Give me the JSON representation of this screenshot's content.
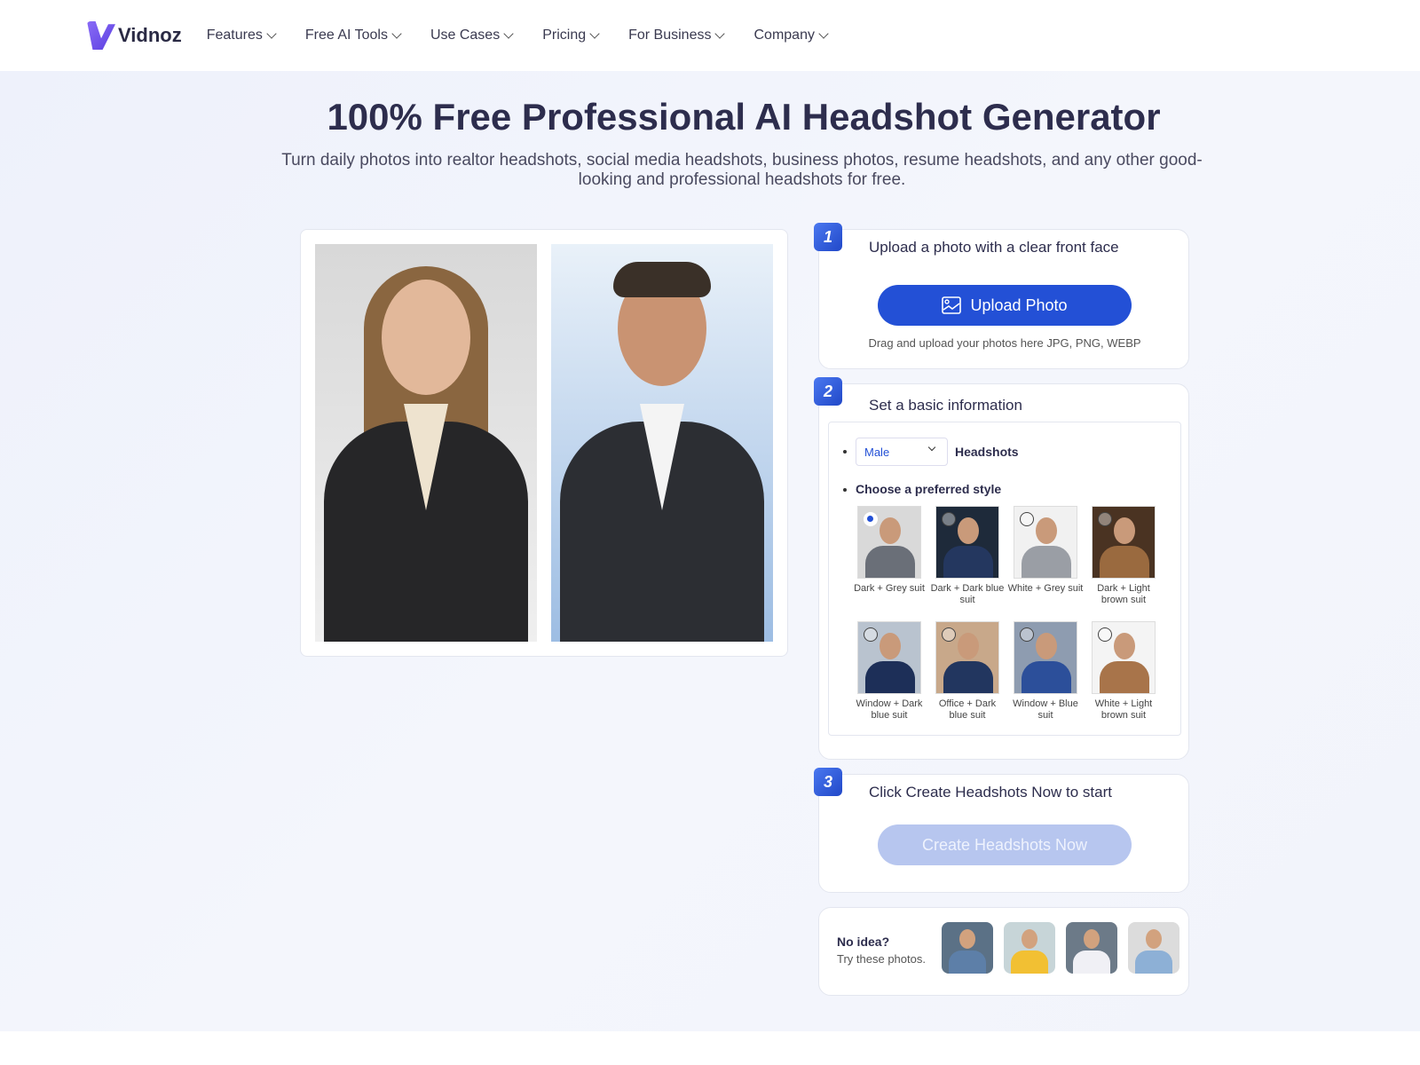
{
  "nav": {
    "logo": "Vidnoz",
    "items": [
      {
        "label": "Features"
      },
      {
        "label": "Free AI Tools"
      },
      {
        "label": "Use Cases"
      },
      {
        "label": "Pricing"
      },
      {
        "label": "For Business"
      },
      {
        "label": "Company"
      }
    ]
  },
  "hero": {
    "title": "100% Free Professional AI Headshot Generator",
    "subtitle": "Turn daily photos into realtor headshots, social media headshots, business photos, resume headshots, and any other good-looking and professional headshots for free."
  },
  "step1": {
    "number": "1",
    "title": "Upload a photo with a clear front face",
    "button": "Upload Photo",
    "hint": "Drag and upload your photos here JPG, PNG, WEBP"
  },
  "step2": {
    "number": "2",
    "title": "Set a basic information",
    "gender": "Male",
    "headshots_label": "Headshots",
    "style_label": "Choose a preferred style",
    "styles": [
      {
        "name": "Dark + Grey suit",
        "selected": true,
        "bg": "#d9d9d9",
        "suit": "#6a6f78"
      },
      {
        "name": "Dark + Dark blue suit",
        "selected": false,
        "bg": "#1e2a3a",
        "suit": "#24375f"
      },
      {
        "name": "White + Grey suit",
        "selected": false,
        "bg": "#f1f1f1",
        "suit": "#9a9ea5"
      },
      {
        "name": "Dark + Light brown suit",
        "selected": false,
        "bg": "#4a3322",
        "suit": "#9a6a3f"
      },
      {
        "name": "Window + Dark blue suit",
        "selected": false,
        "bg": "#b9c3cf",
        "suit": "#1d2f58"
      },
      {
        "name": "Office + Dark blue suit",
        "selected": false,
        "bg": "#c8a88a",
        "suit": "#22365f"
      },
      {
        "name": "Window + Blue suit",
        "selected": false,
        "bg": "#8e9cb0",
        "suit": "#2c4f9a"
      },
      {
        "name": "White + Light brown suit",
        "selected": false,
        "bg": "#f4f4f4",
        "suit": "#a8744a"
      }
    ]
  },
  "step3": {
    "number": "3",
    "title": "Click Create Headshots Now to start",
    "button": "Create Headshots Now"
  },
  "samples": {
    "title": "No idea?",
    "subtitle": "Try these photos.",
    "photos": [
      {
        "bg": "#5b7186",
        "clothes": "#5d7fa8"
      },
      {
        "bg": "#c7d5d8",
        "clothes": "#f2c033"
      },
      {
        "bg": "#6c7a88",
        "clothes": "#f0f0f5"
      },
      {
        "bg": "#dcdcdc",
        "clothes": "#8db0d6"
      }
    ]
  },
  "colors": {
    "primary": "#2350d6",
    "disabled": "#b7c6ef",
    "title": "#2d2d4d"
  }
}
